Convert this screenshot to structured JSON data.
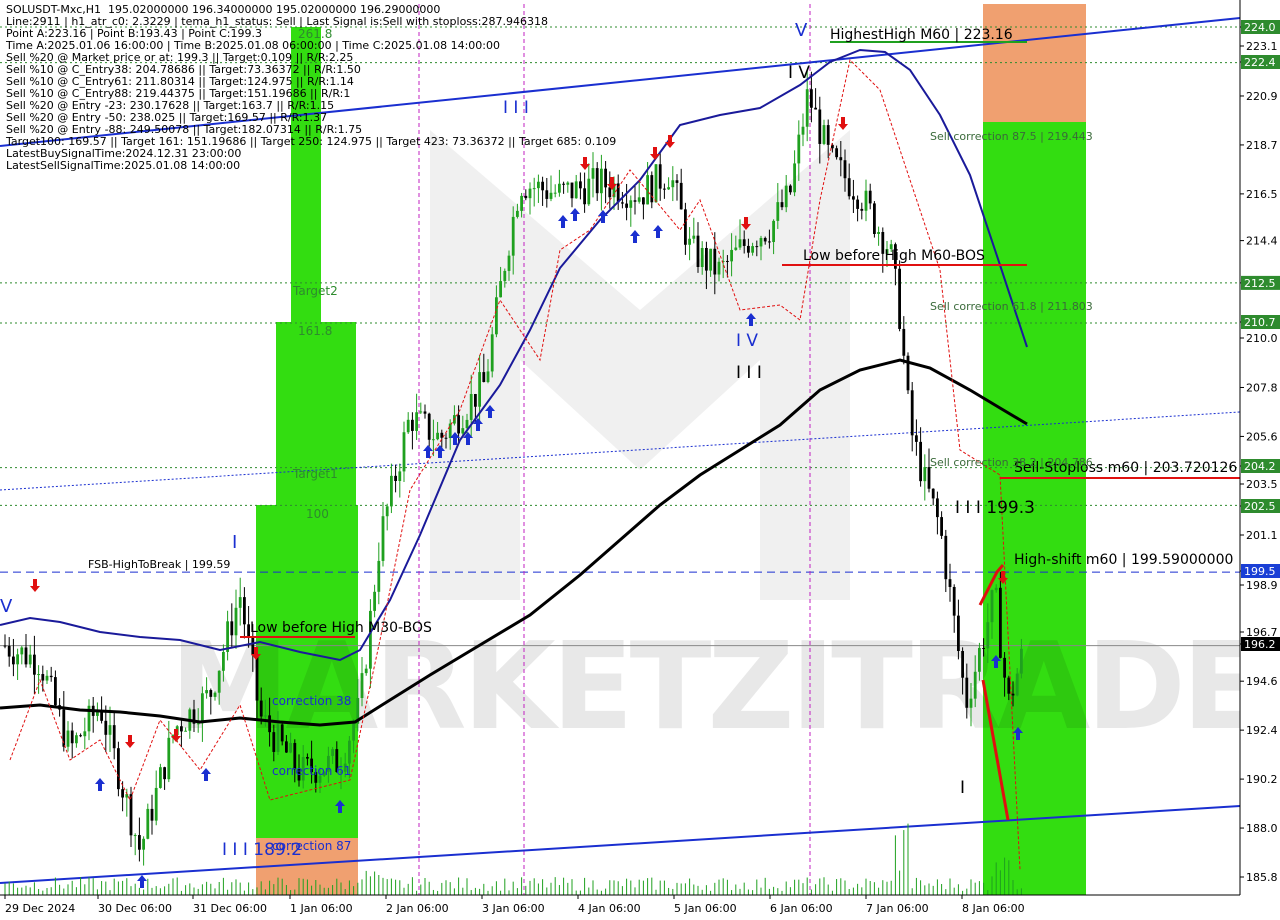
{
  "info_lines": [
    "SOLUSDT-Mxc,H1  195.02000000 196.34000000 195.02000000 196.29000000",
    "Line:2911 | h1_atr_c0: 2.3229 | tema_h1_status: Sell | Last Signal is:Sell with stoploss:287.946318",
    "Point A:223.16 | Point B:193.43 | Point C:199.3",
    "Time A:2025.01.06 16:00:00 | Time B:2025.01.08 06:00:00 | Time C:2025.01.08 14:00:00",
    "Sell %20 @ Market price or at: 199.3 || Target:0.109 || R/R:2.25",
    "Sell %10 @ C_Entry38: 204.78686 || Target:73.36372 || R/R:1.50",
    "Sell %10 @ C_Entry61: 211.80314 || Target:124.975 || R/R:1.14",
    "Sell %10 @ C_Entry88: 219.44375 || Target:151.19686 || R/R:1",
    "Sell %20 @ Entry -23: 230.17628 || Target:163.7 || R/R:1.15",
    "Sell %20 @ Entry -50: 238.025 || Target:169.57 || R/R:1.37",
    "Sell %20 @ Entry -88: 249.50078 || Target:182.07314 || R/R:1.75",
    "Target100: 169.57 || Target 161: 151.19686 || Target 250: 124.975 || Target 423: 73.36372 || Target 685: 0.109",
    "LatestBuySignalTime:2024.12.31 23:00:00",
    "LatestSellSignalTime:2025.01.08 14:00:00"
  ],
  "price_axis": {
    "ticks": [
      "224.0",
      "223.1",
      "222.4",
      "220.9",
      "218.7",
      "216.5",
      "214.4",
      "212.5",
      "210.7",
      "210.0",
      "207.8",
      "205.6",
      "204.2",
      "203.5",
      "202.5",
      "201.1",
      "199.5",
      "198.9",
      "196.7",
      "196.2",
      "194.6",
      "192.4",
      "190.2",
      "188.0",
      "185.8"
    ],
    "highlight_labels": [
      {
        "text": "224.0",
        "color": "#2e8b2e"
      },
      {
        "text": "222.4",
        "color": "#2e8b2e"
      },
      {
        "text": "212.5",
        "color": "#2e8b2e"
      },
      {
        "text": "210.7",
        "color": "#2e8b2e"
      },
      {
        "text": "204.2",
        "color": "#2e8b2e"
      },
      {
        "text": "202.5",
        "color": "#2e8b2e"
      },
      {
        "text": "199.5",
        "color": "#1a3fd6"
      },
      {
        "text": "196.2",
        "color": "#000000"
      }
    ]
  },
  "time_axis": [
    "29 Dec 2024",
    "30 Dec 06:00",
    "31 Dec 06:00",
    "1 Jan 06:00",
    "2 Jan 06:00",
    "3 Jan 06:00",
    "4 Jan 06:00",
    "5 Jan 06:00",
    "6 Jan 06:00",
    "7 Jan 06:00",
    "8 Jan 06:00"
  ],
  "annotations": {
    "highest_high": "HighestHigh   M60 | 223.16",
    "low_before_high_m60": "Low before High   M60-BOS",
    "low_before_high_m30": "Low before High   M30-BOS",
    "sell_correction_875": "Sell correction 87.5 | 219.443",
    "sell_correction_618": "Sell correction 61.8 | 211.803",
    "sell_correction_382": "Sell correction 38.2 | 204.786",
    "sell_stoploss": "Sell-Stoploss m60 | 203.720126",
    "high_shift": "High-shift m60 | 199.59000000",
    "fsb": "FSB-HighToBreak | 199.59",
    "point_c": "I I I 199.3",
    "point_1892": "I I I 189.2",
    "target2": "Target2",
    "target1": "Target1",
    "fib_2618": "261.8",
    "fib_1618": "161.8",
    "fib_100": "100",
    "correction_38": "correction 38",
    "correction_61": "correction 61",
    "correction_87": "correction 87",
    "wave_v": "V",
    "wave_iv_top": "I V",
    "wave_iii_top": "I I I",
    "wave_iv": "I V",
    "wave_iii": "I I I",
    "wave_i_left": "I",
    "wave_i_right": "I",
    "wave_v_left": "V",
    "watermark": "MARKETZITRADE"
  },
  "colors": {
    "green_zone": "#33dd11",
    "orange_zone": "#f0a070",
    "trend_line": "#1a2fd0",
    "ma_black": "#000000",
    "ma_blue": "#1a1a9a",
    "red": "#e01010",
    "grid_green": "#2e8b2e",
    "candle_green": "#1fa01f",
    "candle_black": "#000000"
  }
}
